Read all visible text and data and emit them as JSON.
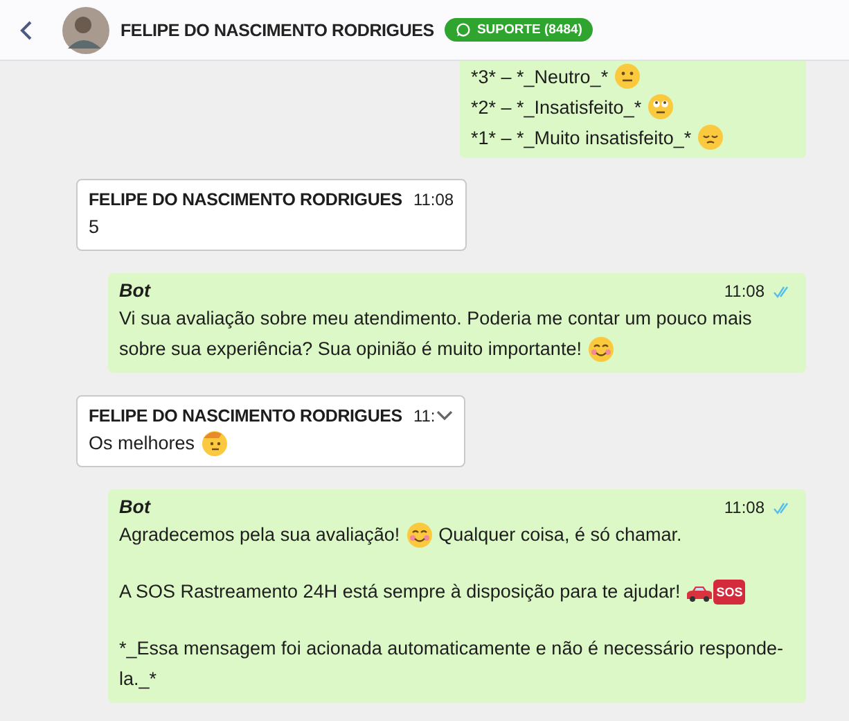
{
  "header": {
    "contact_name": "FELIPE DO NASCIMENTO RODRIGUES",
    "badge": "SUPORTE (8484)"
  },
  "messages": [
    {
      "kind": "outgoing",
      "cut_top": true,
      "paragraphs": [
        [
          [
            {
              "kind": "text",
              "text": "*3* – *_Neutro_*"
            },
            {
              "kind": "neutral_face"
            }
          ],
          [
            {
              "kind": "text",
              "text": "*2* – *_Insatisfeito_*"
            },
            {
              "kind": "eyeroll_face"
            }
          ],
          [
            {
              "kind": "text",
              "text": "*1* – *_Muito insatisfeito_*"
            },
            {
              "kind": "pensive_face"
            }
          ]
        ]
      ]
    },
    {
      "kind": "incoming",
      "sender": "FELIPE DO NASCIMENTO RODRIGUES",
      "time": "11:08",
      "menu": false,
      "paragraphs": [
        [
          [
            {
              "kind": "text",
              "text": "5"
            }
          ]
        ]
      ]
    },
    {
      "kind": "outgoing",
      "sender": "Bot",
      "time": "11:08",
      "read": true,
      "paragraphs": [
        [
          [
            {
              "kind": "text",
              "text": "Vi sua avaliação sobre meu atendimento. Poderia me contar um pouco mais"
            }
          ],
          [
            {
              "kind": "text",
              "text": "sobre sua experiência? Sua opinião é muito importante!"
            },
            {
              "kind": "smiling_face"
            }
          ]
        ]
      ]
    },
    {
      "kind": "incoming",
      "sender": "FELIPE DO NASCIMENTO RODRIGUES",
      "time": "11:",
      "menu": true,
      "paragraphs": [
        [
          [
            {
              "kind": "text",
              "text": "Os melhores"
            },
            {
              "kind": "saluting_face"
            }
          ]
        ]
      ]
    },
    {
      "kind": "outgoing",
      "sender": "Bot",
      "time": "11:08",
      "read": true,
      "paragraphs": [
        [
          [
            {
              "kind": "text",
              "text": "Agradecemos pela sua avaliação!"
            },
            {
              "kind": "smiling_face"
            },
            {
              "kind": "text",
              "text": "Qualquer coisa, é só chamar."
            }
          ]
        ],
        [
          [
            {
              "kind": "text",
              "text": "A SOS Rastreamento 24H está sempre à disposição para te ajudar!"
            },
            {
              "kind": "car"
            },
            {
              "kind": "sos",
              "text": "SOS"
            }
          ]
        ],
        [
          [
            {
              "kind": "text",
              "text": "*_Essa mensagem foi acionada automaticamente e não é necessário responde-"
            }
          ],
          [
            {
              "kind": "text",
              "text": "la._*"
            }
          ]
        ]
      ]
    }
  ]
}
